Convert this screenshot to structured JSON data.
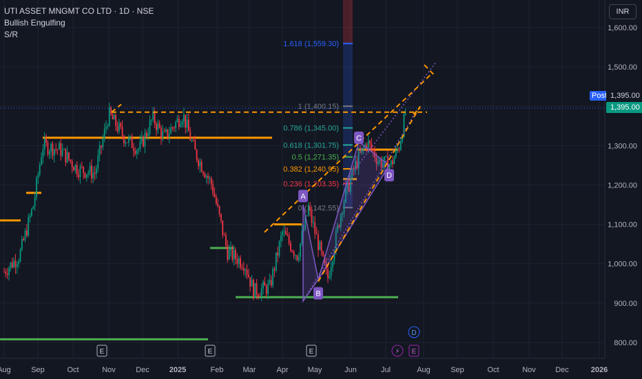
{
  "header": {
    "title": "UTI ASSET MNGMT CO LTD · 1D · NSE",
    "indicators": [
      "Bullish Engulfing",
      "S/R"
    ],
    "currency": "INR"
  },
  "price_tags": {
    "post_label": "Post",
    "post_value": "1,395.00",
    "last_value": "1,395.00"
  },
  "markers": {
    "earnings": "E",
    "dividend": "D",
    "split": "⚡"
  },
  "harmonic_labels": [
    "A",
    "B",
    "C",
    "D"
  ],
  "fib_levels": [
    {
      "label": "1.618 (1,559.30)",
      "color": "#2962ff"
    },
    {
      "label": "1 (1,400.15)",
      "color": "#787b86"
    },
    {
      "label": "0.786 (1,345.00)",
      "color": "#26a69a"
    },
    {
      "label": "0.618 (1,301.75)",
      "color": "#26a69a"
    },
    {
      "label": "0.5 (1,271.35)",
      "color": "#4caf50"
    },
    {
      "label": "0.382 (1,240.95)",
      "color": "#ff9800"
    },
    {
      "label": "0.236 (1,203.35)",
      "color": "#f23645"
    },
    {
      "label": "0 (1,142.55)",
      "color": "#787b86"
    }
  ],
  "chart_data": {
    "type": "candlestick",
    "title": "UTI ASSET MNGMT CO LTD · 1D · NSE",
    "currency": "INR",
    "x_tick_labels": [
      "Aug",
      "Sep",
      "Oct",
      "Nov",
      "Dec",
      "2025",
      "Feb",
      "Mar",
      "Apr",
      "May",
      "Jun",
      "Jul",
      "Aug",
      "Sep",
      "Oct",
      "Nov",
      "Dec",
      "2026"
    ],
    "y_tick_labels": [
      "1,600.00",
      "1,500.00",
      "1,400.00",
      "1,300.00",
      "1,200.00",
      "1,100.00",
      "1,000.00",
      "900.00",
      "800.00"
    ],
    "ylim": [
      770,
      1640
    ],
    "last_price": 1395.0,
    "price_path": [
      [
        "2024-08-01",
        980
      ],
      [
        "2024-08-15",
        1020
      ],
      [
        "2024-08-28",
        1150
      ],
      [
        "2024-09-05",
        1300
      ],
      [
        "2024-09-20",
        1290
      ],
      [
        "2024-10-05",
        1240
      ],
      [
        "2024-10-20",
        1230
      ],
      [
        "2024-11-01",
        1380
      ],
      [
        "2024-11-15",
        1320
      ],
      [
        "2024-11-28",
        1290
      ],
      [
        "2024-12-10",
        1370
      ],
      [
        "2024-12-20",
        1320
      ],
      [
        "2025-01-05",
        1380
      ],
      [
        "2025-01-15",
        1280
      ],
      [
        "2025-01-28",
        1200
      ],
      [
        "2025-02-10",
        1030
      ],
      [
        "2025-02-25",
        1000
      ],
      [
        "2025-03-05",
        930
      ],
      [
        "2025-03-20",
        940
      ],
      [
        "2025-04-01",
        1080
      ],
      [
        "2025-04-15",
        1020
      ],
      [
        "2025-04-25",
        1140
      ],
      [
        "2025-05-05",
        1040
      ],
      [
        "2025-05-12",
        960
      ],
      [
        "2025-05-25",
        1150
      ],
      [
        "2025-06-05",
        1250
      ],
      [
        "2025-06-15",
        1310
      ],
      [
        "2025-06-25",
        1260
      ],
      [
        "2025-07-05",
        1250
      ],
      [
        "2025-07-12",
        1300
      ],
      [
        "2025-07-18",
        1395
      ]
    ],
    "support_resistance": [
      1320,
      1180,
      1110,
      1040,
      915,
      808
    ],
    "fibonacci": {
      "1.618": 1559.3,
      "1": 1400.15,
      "0.786": 1345.0,
      "0.618": 1301.75,
      "0.5": 1271.35,
      "0.382": 1240.95,
      "0.236": 1203.35,
      "0": 1142.55
    },
    "pattern_points": {
      "A": 1150,
      "B": 960,
      "C": 1310,
      "D": 1250
    }
  }
}
